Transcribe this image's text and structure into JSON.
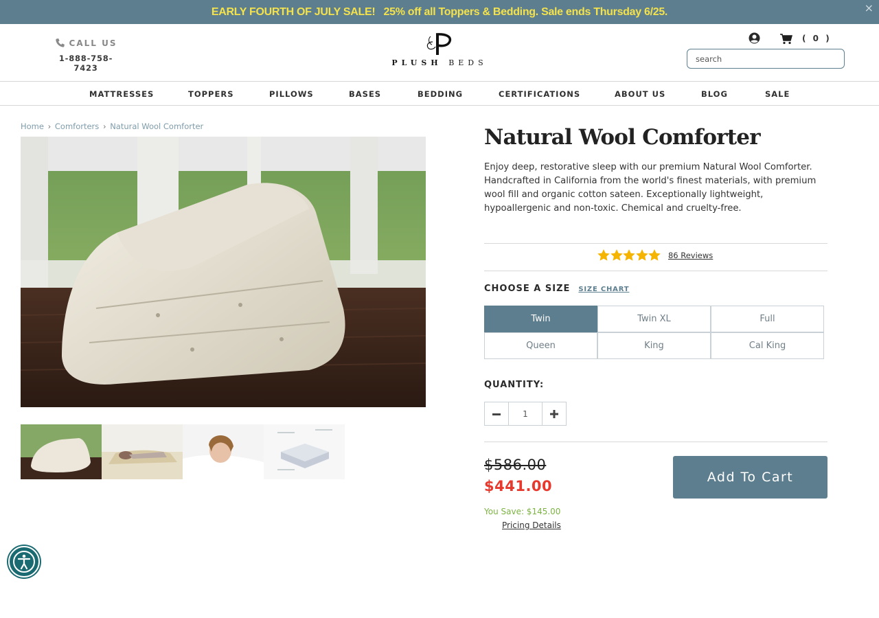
{
  "promo": {
    "part1": "EARLY FOURTH OF JULY SALE!",
    "part2": "25% off all Toppers & Bedding. Sale ends Thursday 6/25.",
    "close": "×"
  },
  "header": {
    "call_label": "CALL US",
    "phone": "1-888-758-7423",
    "logo_bold": "PLUSH",
    "logo_light": "BEDS",
    "cart_count": "( 0 )",
    "search_placeholder": "search"
  },
  "nav": [
    "MATTRESSES",
    "TOPPERS",
    "PILLOWS",
    "BASES",
    "BEDDING",
    "CERTIFICATIONS",
    "ABOUT US",
    "BLOG",
    "SALE"
  ],
  "breadcrumb": {
    "home": "Home",
    "category": "Comforters",
    "current": "Natural Wool Comforter",
    "separator": "›"
  },
  "product": {
    "title": "Natural Wool Comforter",
    "description": "Enjoy deep, restorative sleep with our premium Natural Wool Comforter. Handcrafted in California from the world's finest materials, with premium wool fill and organic cotton sateen. Exceptionally lightweight, hypoallergenic and non-toxic. Chemical and cruelty-free.",
    "rating": 5,
    "reviews": "86 Reviews",
    "choose_size": "CHOOSE A SIZE",
    "size_chart": "SIZE CHART",
    "sizes": [
      "Twin",
      "Twin XL",
      "Full",
      "Queen",
      "King",
      "Cal King"
    ],
    "selected_size": "Twin",
    "quantity_label": "QUANTITY:",
    "quantity": "1",
    "old_price": "$586.00",
    "new_price": "$441.00",
    "you_save": "You Save: $145.00",
    "pricing_details": "Pricing Details",
    "add_to_cart": "Add To Cart"
  },
  "colors": {
    "accent": "#5d7e8e",
    "promo_text": "#f4e24c",
    "sale_price": "#e8392e",
    "savings": "#7cb342",
    "star": "#f5b400"
  }
}
